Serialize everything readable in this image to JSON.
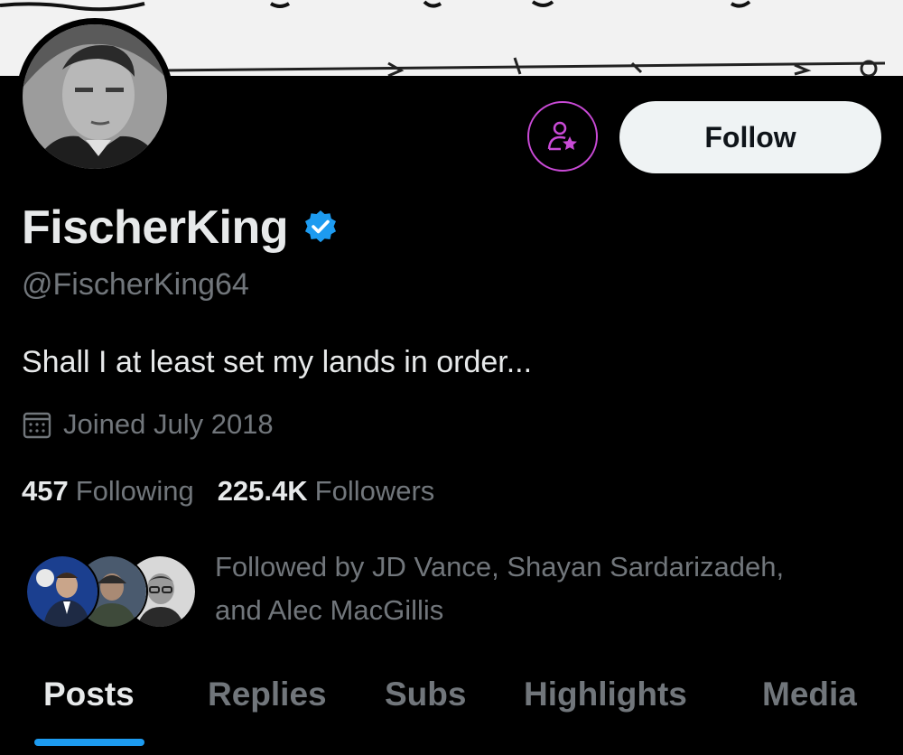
{
  "profile": {
    "display_name": "FischerKing",
    "handle": "@FischerKing64",
    "bio": "Shall I at least set my lands in order...",
    "joined": "Joined July 2018",
    "verified_icon": "verified-badge-icon",
    "accent_color": "#1d9bf0",
    "subscribe_color": "#c94ad6"
  },
  "actions": {
    "follow_label": "Follow",
    "subscribe_icon": "user-star-icon"
  },
  "stats": {
    "following_count": "457",
    "following_label": "Following",
    "followers_count": "225.4K",
    "followers_label": "Followers"
  },
  "followed_by": {
    "text_line1": "Followed by JD Vance, Shayan Sardarizadeh,",
    "text_line2": "and Alec MacGillis"
  },
  "tabs": [
    {
      "label": "Posts",
      "active": true
    },
    {
      "label": "Replies",
      "active": false
    },
    {
      "label": "Subs",
      "active": false
    },
    {
      "label": "Highlights",
      "active": false
    },
    {
      "label": "Media",
      "active": false
    }
  ]
}
